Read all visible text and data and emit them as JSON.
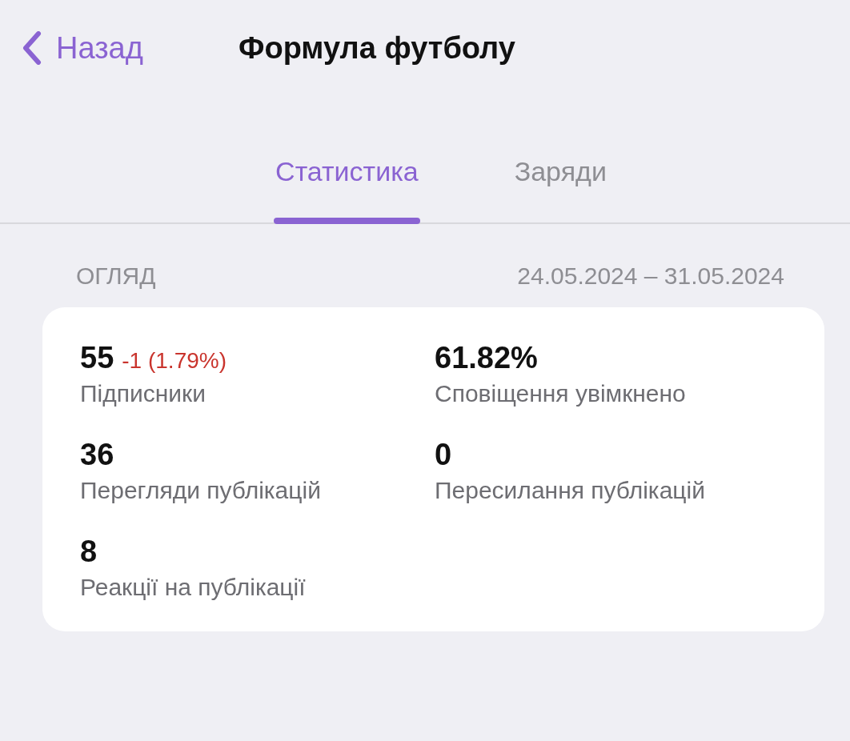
{
  "nav": {
    "back": "Назад",
    "title": "Формула футболу"
  },
  "tabs": [
    {
      "label": "Статистика",
      "selected": true
    },
    {
      "label": "Заряди",
      "selected": false
    }
  ],
  "overview": {
    "heading": "ОГЛЯД",
    "period": "24.05.2024 – 31.05.2024",
    "metrics": [
      {
        "value": "55",
        "change": "-1 (1.79%)",
        "label": "Підписники"
      },
      {
        "value": "61.82%",
        "label": "Сповіщення увімкнено"
      },
      {
        "value": "36",
        "label": "Перегляди публікацій"
      },
      {
        "value": "0",
        "label": "Пересилання публікацій"
      },
      {
        "value": "8",
        "label": "Реакції на публікації"
      }
    ]
  }
}
